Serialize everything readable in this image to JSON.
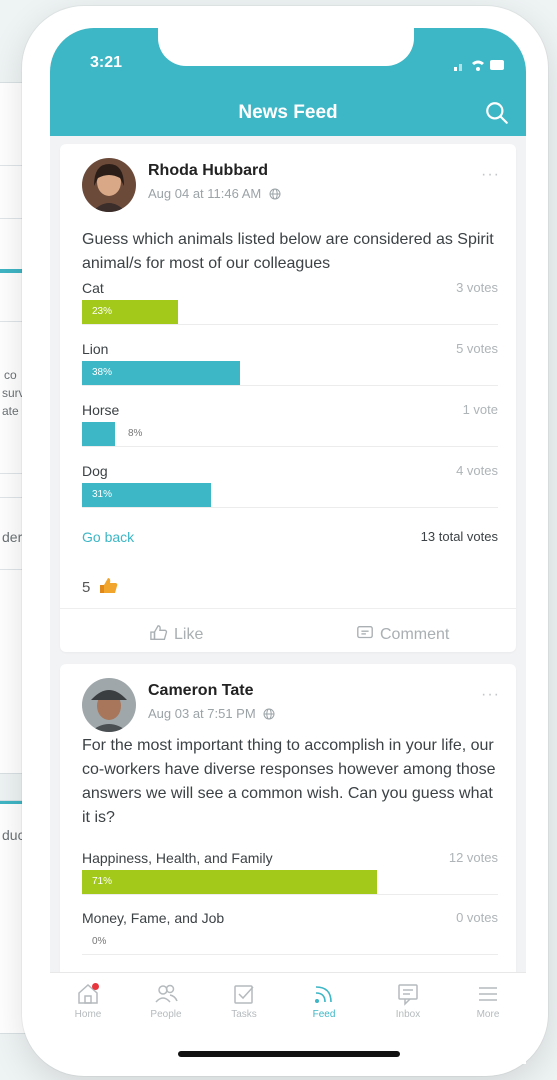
{
  "app": {
    "status_time": "3:21",
    "title": "News Feed",
    "accent_color": "#3db6c5",
    "green_color": "#a3c91a"
  },
  "background": {
    "text_fragments": [
      "co",
      "surv",
      "ate",
      "ders",
      "duc"
    ]
  },
  "posts": [
    {
      "author": "Rhoda Hubbard",
      "timestamp": "Aug 04 at 11:46 AM",
      "more": "···",
      "text": "Guess which animals listed below are considered as Spirit animal/s for most of our colleagues",
      "options": [
        {
          "label": "Cat",
          "votes": "3 votes",
          "percent": 23,
          "percent_label": "23%",
          "color": "#a3c91a"
        },
        {
          "label": "Lion",
          "votes": "5 votes",
          "percent": 38,
          "percent_label": "38%",
          "color": "#3db6c5"
        },
        {
          "label": "Horse",
          "votes": "1 vote",
          "percent": 8,
          "percent_label": "8%",
          "color": "#3db6c5"
        },
        {
          "label": "Dog",
          "votes": "4 votes",
          "percent": 31,
          "percent_label": "31%",
          "color": "#3db6c5"
        }
      ],
      "go_back": "Go back",
      "total_votes": "13 total votes",
      "like_count": "5",
      "actions": {
        "like": "Like",
        "comment": "Comment"
      }
    },
    {
      "author": "Cameron Tate",
      "timestamp": "Aug 03 at 7:51 PM",
      "more": "···",
      "text": "For the most important thing to accomplish in your life, our co-workers have diverse responses however among those answers we will see a common wish. Can you guess what it is?",
      "options": [
        {
          "label": "Happiness, Health, and Family",
          "votes": "12 votes",
          "percent": 71,
          "percent_label": "71%",
          "color": "#a3c91a"
        },
        {
          "label": "Money, Fame, and Job",
          "votes": "0 votes",
          "percent": 0,
          "percent_label": "0%",
          "color": "#3db6c5"
        }
      ]
    }
  ],
  "nav": {
    "items": [
      {
        "label": "Home",
        "icon": "home-icon"
      },
      {
        "label": "People",
        "icon": "people-icon"
      },
      {
        "label": "Tasks",
        "icon": "tasks-icon"
      },
      {
        "label": "Feed",
        "icon": "feed-icon",
        "active": true
      },
      {
        "label": "Inbox",
        "icon": "inbox-icon"
      },
      {
        "label": "More",
        "icon": "menu-icon"
      }
    ]
  }
}
